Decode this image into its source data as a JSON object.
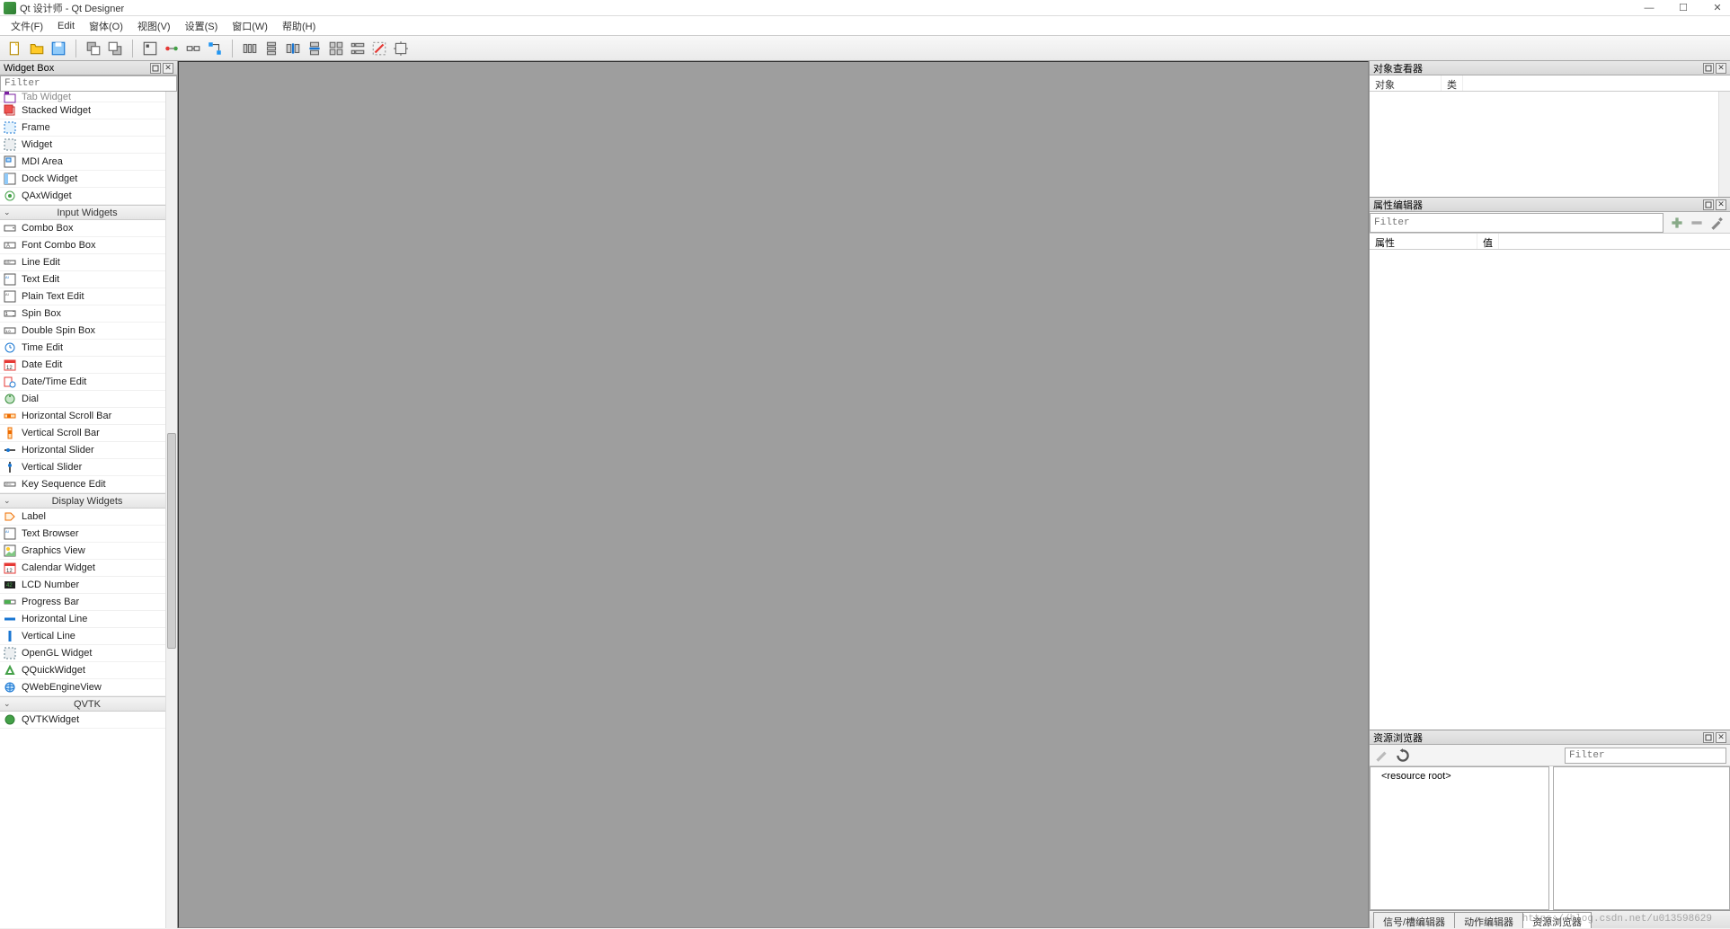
{
  "window": {
    "title": "Qt 设计师 - Qt Designer"
  },
  "menu": {
    "items": [
      "文件(F)",
      "Edit",
      "窗体(O)",
      "视图(V)",
      "设置(S)",
      "窗口(W)",
      "帮助(H)"
    ]
  },
  "widgetbox": {
    "title": "Widget Box",
    "filter_placeholder": "Filter",
    "partial_item": "Tab Widget",
    "containers_tail": [
      "Stacked Widget",
      "Frame",
      "Widget",
      "MDI Area",
      "Dock Widget",
      "QAxWidget"
    ],
    "categories": [
      {
        "name": "Input Widgets",
        "items": [
          "Combo Box",
          "Font Combo Box",
          "Line Edit",
          "Text Edit",
          "Plain Text Edit",
          "Spin Box",
          "Double Spin Box",
          "Time Edit",
          "Date Edit",
          "Date/Time Edit",
          "Dial",
          "Horizontal Scroll Bar",
          "Vertical Scroll Bar",
          "Horizontal Slider",
          "Vertical Slider",
          "Key Sequence Edit"
        ]
      },
      {
        "name": "Display Widgets",
        "items": [
          "Label",
          "Text Browser",
          "Graphics View",
          "Calendar Widget",
          "LCD Number",
          "Progress Bar",
          "Horizontal Line",
          "Vertical Line",
          "OpenGL Widget",
          "QQuickWidget",
          "QWebEngineView"
        ]
      },
      {
        "name": "QVTK",
        "items": [
          "QVTKWidget"
        ]
      }
    ]
  },
  "object_inspector": {
    "title": "对象查看器",
    "col_object": "对象",
    "col_class": "类"
  },
  "property_editor": {
    "title": "属性编辑器",
    "filter_placeholder": "Filter",
    "col_property": "属性",
    "col_value": "值"
  },
  "resource_browser": {
    "title": "资源浏览器",
    "filter_placeholder": "Filter",
    "root_label": "<resource root>"
  },
  "bottom_tabs": {
    "signal_slot": "信号/槽编辑器",
    "action_editor": "动作编辑器",
    "resource_browser": "资源浏览器"
  },
  "watermark": "https://blog.csdn.net/u013598629"
}
